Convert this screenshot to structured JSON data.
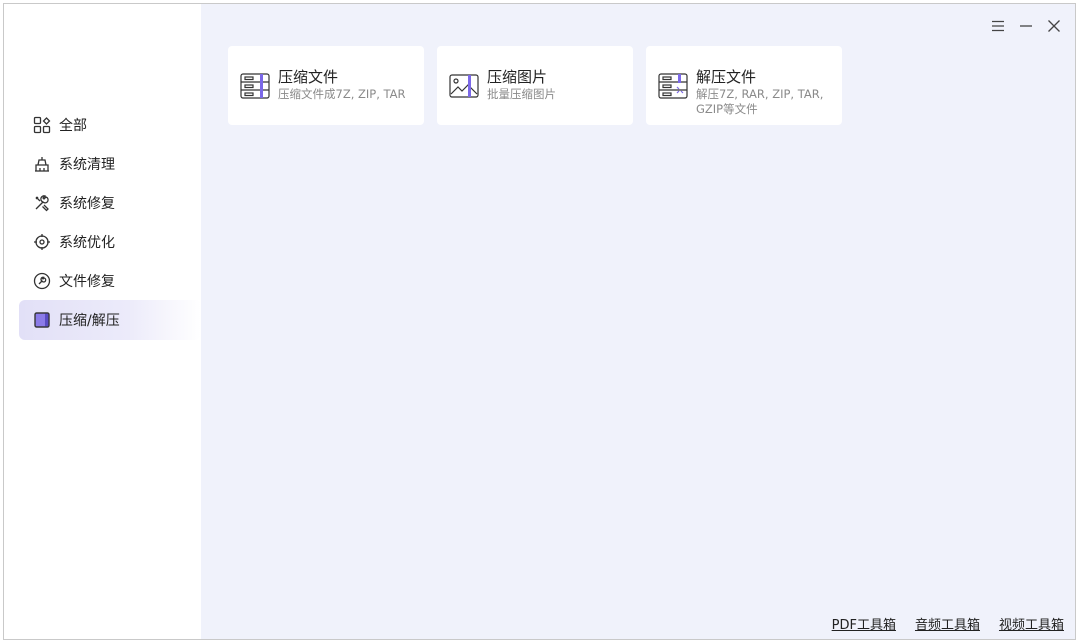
{
  "window_controls": {
    "menu_icon": "menu-icon",
    "minimize_icon": "minimize-icon",
    "close_icon": "close-icon"
  },
  "sidebar": {
    "items": [
      {
        "label": "全部",
        "icon": "grid-icon",
        "active": false
      },
      {
        "label": "系统清理",
        "icon": "broom-icon",
        "active": false
      },
      {
        "label": "系统修复",
        "icon": "wrench-icon",
        "active": false
      },
      {
        "label": "系统优化",
        "icon": "target-icon",
        "active": false
      },
      {
        "label": "文件修复",
        "icon": "file-repair-icon",
        "active": false
      },
      {
        "label": "压缩/解压",
        "icon": "archive-icon",
        "active": true
      }
    ]
  },
  "cards": [
    {
      "title": "压缩文件",
      "subtitle": "压缩文件成7Z, ZIP, TAR",
      "icon": "compress-file-icon"
    },
    {
      "title": "压缩图片",
      "subtitle": "批量压缩图片",
      "icon": "compress-image-icon"
    },
    {
      "title": "解压文件",
      "subtitle": "解压7Z, RAR, ZIP, TAR, GZIP等文件",
      "icon": "extract-file-icon"
    }
  ],
  "footer": {
    "links": [
      "PDF工具箱",
      "音频工具箱",
      "视频工具箱"
    ]
  },
  "colors": {
    "accent": "#7b68e8",
    "main_bg": "#f0f2fb"
  }
}
